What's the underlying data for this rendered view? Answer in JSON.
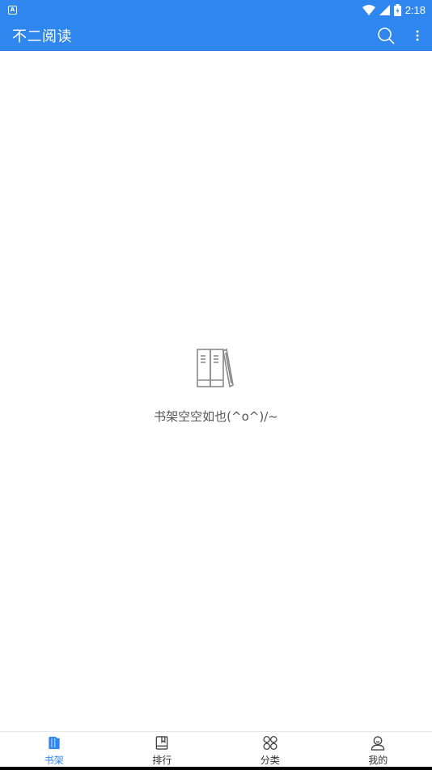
{
  "status": {
    "time": "2:18",
    "notification_icon": "A",
    "icons": [
      "wifi-icon",
      "signal-icon",
      "battery-charging-icon"
    ]
  },
  "appbar": {
    "title": "不二阅读",
    "actions": [
      "search-icon",
      "more-vert-icon"
    ]
  },
  "empty_state": {
    "icon": "bookshelf-icon",
    "message": "书架空空如也(^o^)/~"
  },
  "tabs": [
    {
      "label": "书架",
      "icon": "bookshelf-tab-icon",
      "active": true
    },
    {
      "label": "排行",
      "icon": "book-rank-icon",
      "active": false
    },
    {
      "label": "分类",
      "icon": "category-icon",
      "active": false
    },
    {
      "label": "我的",
      "icon": "profile-icon",
      "active": false
    }
  ],
  "colors": {
    "primary": "#2f86ee",
    "text_muted": "#555555",
    "tab_inactive": "#333333",
    "icon_gray": "#8a8a8a"
  }
}
